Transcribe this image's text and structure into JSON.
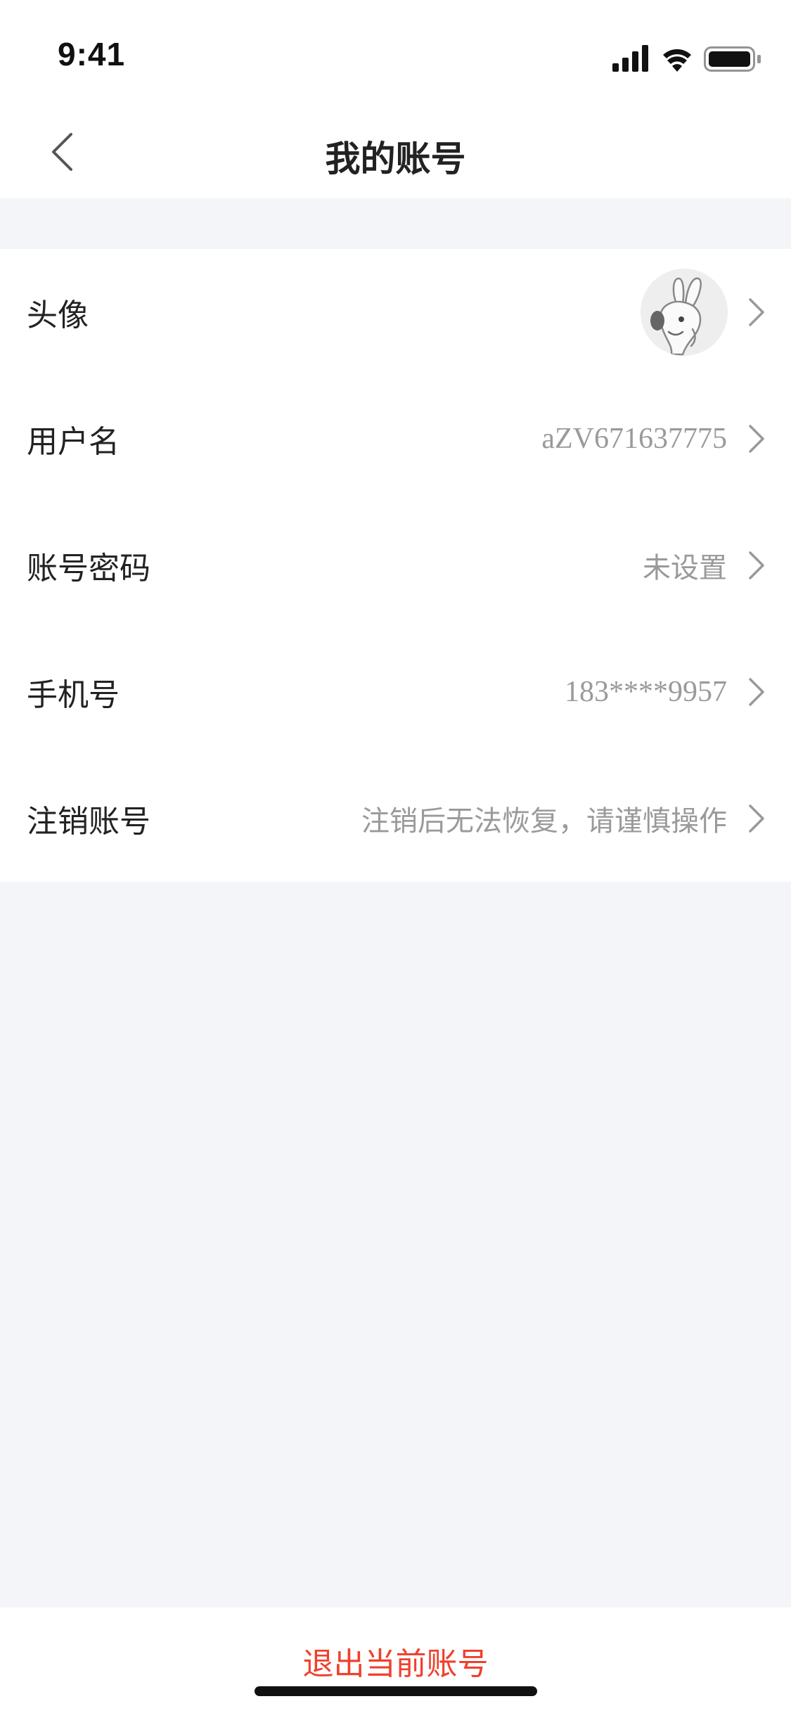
{
  "status_bar": {
    "time": "9:41",
    "icons": [
      "signal-icon",
      "wifi-icon",
      "battery-icon"
    ]
  },
  "nav": {
    "back_icon": "chevron-left-icon",
    "title": "我的账号"
  },
  "rows": [
    {
      "label": "头像",
      "value": "",
      "avatar": "rabbit-avatar-icon"
    },
    {
      "label": "用户名",
      "value": "aZV671637775"
    },
    {
      "label": "账号密码",
      "value": "未设置"
    },
    {
      "label": "手机号",
      "value": "183****9957"
    },
    {
      "label": "注销账号",
      "value": "注销后无法恢复，请谨慎操作"
    }
  ],
  "footer": {
    "logout_label": "退出当前账号"
  },
  "colors": {
    "background": "#f4f5f9",
    "surface": "#ffffff",
    "text_primary": "#222222",
    "text_secondary": "#9a9a9a",
    "danger": "#f0402d"
  }
}
